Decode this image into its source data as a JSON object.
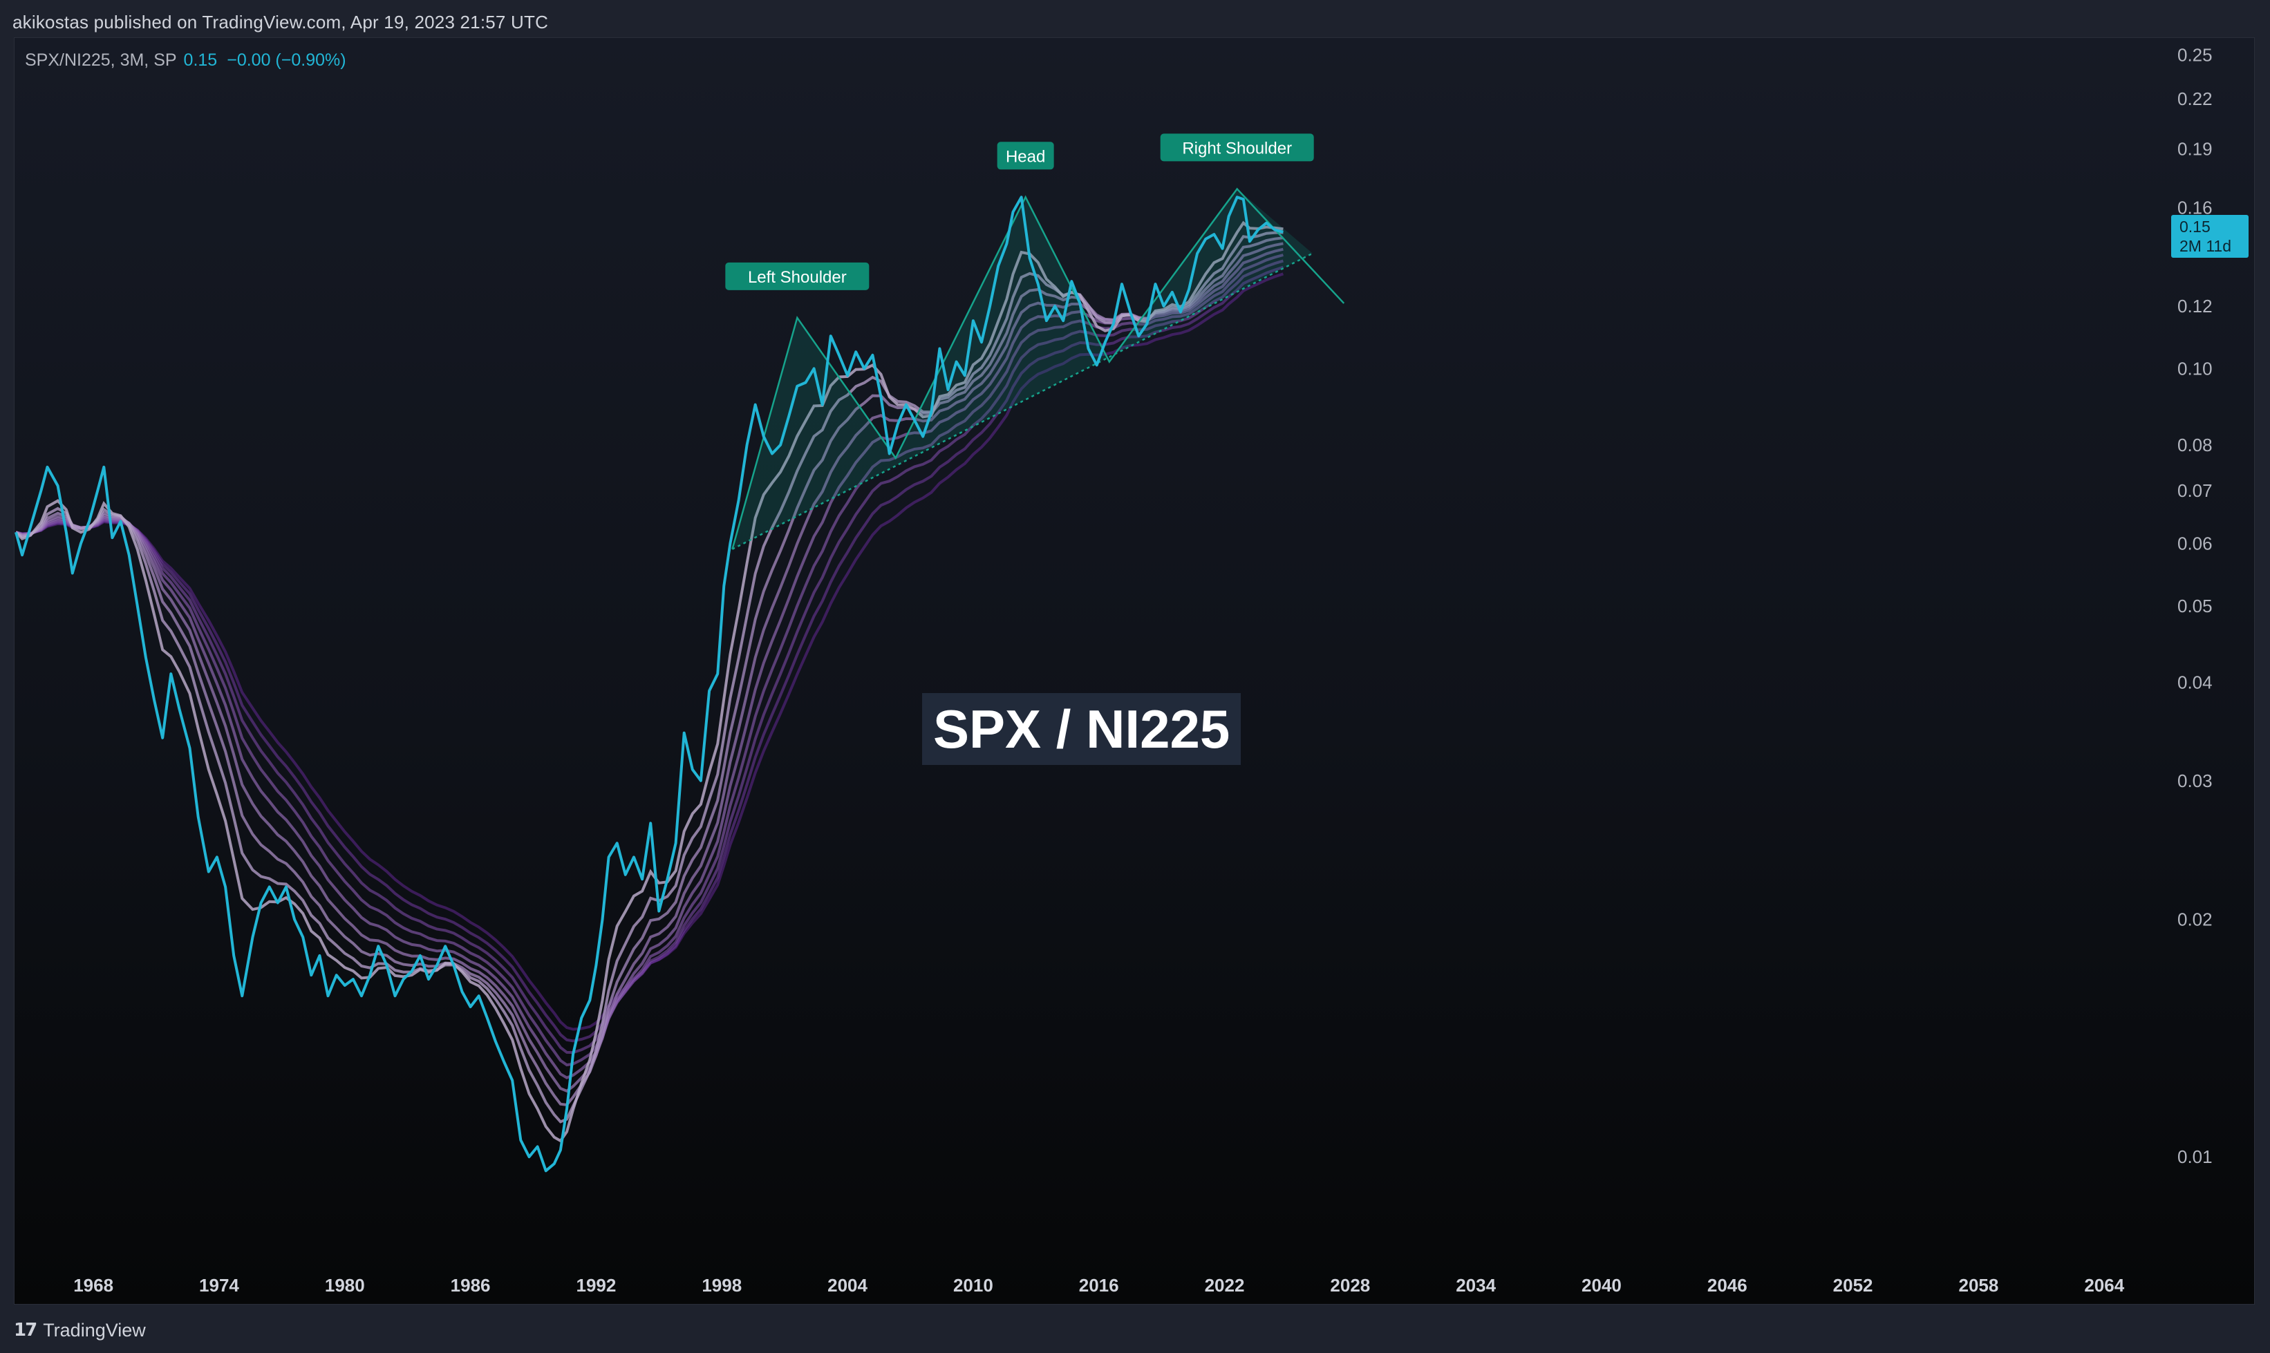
{
  "header": {
    "publish_info": "akikostas published on TradingView.com, Apr 19, 2023 21:57 UTC"
  },
  "legend": {
    "symbol": "SPX/NI225, 3M, SP",
    "value": "0.15",
    "change": "−0.00 (−0.90%)"
  },
  "price_badge": {
    "price": "0.15",
    "countdown": "2M 11d"
  },
  "watermark": "SPX / NI225",
  "footer": {
    "logo": "17",
    "brand": "TradingView"
  },
  "colors": {
    "price_line": "#22b6d6",
    "pattern_fill": "#0f8a78",
    "label_bg": "#0e8a72",
    "ribbon_light": "#b7a8c7",
    "ribbon_dark": "#7a2fa8"
  },
  "chart_data": {
    "type": "line",
    "title": "",
    "xlabel": "",
    "ylabel": "",
    "y_scale": "log",
    "ylim": [
      0.0073,
      0.26
    ],
    "xlim": [
      1964.2,
      2066.5
    ],
    "x_ticks": [
      "1968",
      "1974",
      "1980",
      "1986",
      "1992",
      "1998",
      "2004",
      "2010",
      "2016",
      "2022",
      "2028",
      "2034",
      "2040",
      "2046",
      "2052",
      "2058",
      "2064"
    ],
    "y_ticks": [
      "0.25",
      "0.22",
      "0.19",
      "0.16",
      "0.12",
      "0.10",
      "0.08",
      "0.07",
      "0.06",
      "0.05",
      "0.04",
      "0.03",
      "0.02",
      "0.01"
    ],
    "series": [
      {
        "points": [
          [
            1964.3,
            0.062
          ],
          [
            1964.6,
            0.058
          ],
          [
            1965,
            0.063
          ],
          [
            1965.5,
            0.07
          ],
          [
            1965.8,
            0.075
          ],
          [
            1966.3,
            0.071
          ],
          [
            1966.7,
            0.062
          ],
          [
            1967,
            0.055
          ],
          [
            1967.4,
            0.06
          ],
          [
            1967.8,
            0.064
          ],
          [
            1968.2,
            0.07
          ],
          [
            1968.5,
            0.075
          ],
          [
            1968.9,
            0.061
          ],
          [
            1969.3,
            0.064
          ],
          [
            1969.7,
            0.058
          ],
          [
            1970.1,
            0.05
          ],
          [
            1970.5,
            0.043
          ],
          [
            1970.9,
            0.038
          ],
          [
            1971.3,
            0.034
          ],
          [
            1971.7,
            0.041
          ],
          [
            1972.1,
            0.037
          ],
          [
            1972.6,
            0.033
          ],
          [
            1973,
            0.027
          ],
          [
            1973.5,
            0.023
          ],
          [
            1973.9,
            0.024
          ],
          [
            1974.3,
            0.022
          ],
          [
            1974.7,
            0.018
          ],
          [
            1975.1,
            0.016
          ],
          [
            1975.6,
            0.019
          ],
          [
            1976,
            0.021
          ],
          [
            1976.4,
            0.022
          ],
          [
            1976.8,
            0.021
          ],
          [
            1977.2,
            0.022
          ],
          [
            1977.6,
            0.02
          ],
          [
            1978,
            0.019
          ],
          [
            1978.4,
            0.017
          ],
          [
            1978.8,
            0.018
          ],
          [
            1979.2,
            0.016
          ],
          [
            1979.6,
            0.017
          ],
          [
            1980,
            0.0165
          ],
          [
            1980.4,
            0.0168
          ],
          [
            1980.8,
            0.016
          ],
          [
            1981.2,
            0.017
          ],
          [
            1981.6,
            0.0185
          ],
          [
            1982,
            0.0175
          ],
          [
            1982.4,
            0.016
          ],
          [
            1982.8,
            0.0168
          ],
          [
            1983.2,
            0.0172
          ],
          [
            1983.6,
            0.018
          ],
          [
            1984,
            0.0168
          ],
          [
            1984.4,
            0.0175
          ],
          [
            1984.8,
            0.0185
          ],
          [
            1985.2,
            0.0175
          ],
          [
            1985.6,
            0.0162
          ],
          [
            1986,
            0.0155
          ],
          [
            1986.4,
            0.016
          ],
          [
            1986.8,
            0.015
          ],
          [
            1987.2,
            0.014
          ],
          [
            1987.6,
            0.0132
          ],
          [
            1988,
            0.0125
          ],
          [
            1988.4,
            0.0105
          ],
          [
            1988.8,
            0.01
          ],
          [
            1989.2,
            0.0103
          ],
          [
            1989.6,
            0.0096
          ],
          [
            1990,
            0.0098
          ],
          [
            1990.3,
            0.0102
          ],
          [
            1990.6,
            0.0115
          ],
          [
            1990.9,
            0.0135
          ],
          [
            1991.3,
            0.015
          ],
          [
            1991.7,
            0.0158
          ],
          [
            1992,
            0.0175
          ],
          [
            1992.3,
            0.02
          ],
          [
            1992.6,
            0.024
          ],
          [
            1993,
            0.025
          ],
          [
            1993.4,
            0.0228
          ],
          [
            1993.8,
            0.024
          ],
          [
            1994.2,
            0.0225
          ],
          [
            1994.6,
            0.0265
          ],
          [
            1995,
            0.0205
          ],
          [
            1995.4,
            0.0225
          ],
          [
            1995.8,
            0.025
          ],
          [
            1996.2,
            0.0345
          ],
          [
            1996.6,
            0.031
          ],
          [
            1997,
            0.03
          ],
          [
            1997.4,
            0.039
          ],
          [
            1997.8,
            0.041
          ],
          [
            1998.1,
            0.053
          ],
          [
            1998.4,
            0.06
          ],
          [
            1998.8,
            0.068
          ],
          [
            1999.2,
            0.08
          ],
          [
            1999.6,
            0.09
          ],
          [
            2000,
            0.082
          ],
          [
            2000.4,
            0.078
          ],
          [
            2000.8,
            0.08
          ],
          [
            2001.2,
            0.087
          ],
          [
            2001.6,
            0.095
          ],
          [
            2002,
            0.096
          ],
          [
            2002.4,
            0.1
          ],
          [
            2002.8,
            0.09
          ],
          [
            2003.2,
            0.11
          ],
          [
            2003.6,
            0.104
          ],
          [
            2004,
            0.098
          ],
          [
            2004.4,
            0.105
          ],
          [
            2004.8,
            0.1
          ],
          [
            2005.2,
            0.104
          ],
          [
            2005.6,
            0.092
          ],
          [
            2006,
            0.078
          ],
          [
            2006.4,
            0.085
          ],
          [
            2006.8,
            0.09
          ],
          [
            2007.2,
            0.086
          ],
          [
            2007.6,
            0.082
          ],
          [
            2008,
            0.088
          ],
          [
            2008.4,
            0.106
          ],
          [
            2008.8,
            0.094
          ],
          [
            2009.2,
            0.102
          ],
          [
            2009.6,
            0.098
          ],
          [
            2010,
            0.115
          ],
          [
            2010.4,
            0.108
          ],
          [
            2010.8,
            0.12
          ],
          [
            2011.2,
            0.135
          ],
          [
            2011.6,
            0.144
          ],
          [
            2011.9,
            0.158
          ],
          [
            2012.3,
            0.165
          ],
          [
            2012.7,
            0.138
          ],
          [
            2013.1,
            0.128
          ],
          [
            2013.5,
            0.115
          ],
          [
            2013.9,
            0.12
          ],
          [
            2014.3,
            0.115
          ],
          [
            2014.7,
            0.129
          ],
          [
            2015.1,
            0.121
          ],
          [
            2015.5,
            0.106
          ],
          [
            2015.9,
            0.101
          ],
          [
            2016.3,
            0.108
          ],
          [
            2016.7,
            0.114
          ],
          [
            2017.1,
            0.128
          ],
          [
            2017.5,
            0.118
          ],
          [
            2017.9,
            0.11
          ],
          [
            2018.3,
            0.114
          ],
          [
            2018.7,
            0.128
          ],
          [
            2019.1,
            0.12
          ],
          [
            2019.5,
            0.125
          ],
          [
            2019.9,
            0.118
          ],
          [
            2020.3,
            0.126
          ],
          [
            2020.7,
            0.14
          ],
          [
            2021.1,
            0.146
          ],
          [
            2021.5,
            0.148
          ],
          [
            2021.9,
            0.142
          ],
          [
            2022.2,
            0.156
          ],
          [
            2022.6,
            0.165
          ],
          [
            2022.9,
            0.164
          ],
          [
            2023.2,
            0.145
          ],
          [
            2023.6,
            0.15
          ],
          [
            2024,
            0.153
          ],
          [
            2024.4,
            0.15
          ],
          [
            2024.8,
            0.149
          ]
        ]
      }
    ],
    "pattern_points": [
      [
        1998.5,
        0.059
      ],
      [
        2001.6,
        0.116
      ],
      [
        2006.3,
        0.077
      ],
      [
        2012.5,
        0.165
      ],
      [
        2016.5,
        0.102
      ],
      [
        2022.6,
        0.169
      ],
      [
        2027.7,
        0.121
      ]
    ],
    "neckline": [
      [
        1998.5,
        0.059
      ],
      [
        2026.2,
        0.14
      ]
    ],
    "annotations": [
      {
        "text": "Left Shoulder",
        "x": 2001.6,
        "y": 0.116
      },
      {
        "text": "Head",
        "x": 2012.5,
        "y": 0.165
      },
      {
        "text": "Right Shoulder",
        "x": 2022.6,
        "y": 0.169
      }
    ]
  }
}
